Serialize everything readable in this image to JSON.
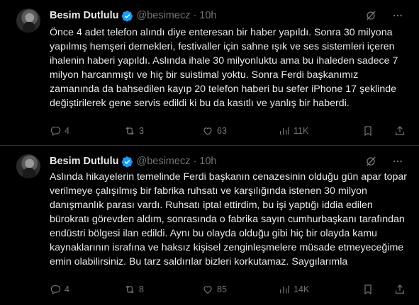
{
  "tweets": [
    {
      "author_name": "Besim Dutlulu",
      "handle": "@besimecz",
      "time_sep": "·",
      "time": "10h",
      "text": "Önce 4 adet telefon alındı diye enteresan bir haber yapıldı. Sonra 30 milyona yapılmış  hemşeri dernekleri, festivaller için sahne ışık ve ses sistemleri içeren ihalenin haberi yapıldı. Aslında ihale 30 milyonluktu ama bu ihaleden sadece 7 milyon harcanmıştı ve hiç bir suistimal yoktu. Sonra Ferdi başkanımız zamanında da bahsedilen kayıp 20 telefon haberi bu sefer iPhone 17 şeklinde değiştirilerek gene servis edildi ki bu da kasıtlı ve yanlış bir haberdi.",
      "replies": "4",
      "reposts": "3",
      "likes": "63",
      "views": "11K"
    },
    {
      "author_name": "Besim Dutlulu",
      "handle": "@besimecz",
      "time_sep": "·",
      "time": "10h",
      "text": "Aslında hikayelerin temelinde Ferdi başkanın cenazesinin olduğu gün apar topar verilmeye çalışılmış bir fabrika ruhsatı ve karşılığında istenen 30 milyon danışmanlık parası vardı. Ruhsatı iptal ettirdim, bu işi yaptığı iddia edilen bürokratı görevden aldım, sonrasında o fabrika sayın cumhurbaşkanı tarafından endüstri bölgesi ilan edildi. Aynı bu olayda olduğu gibi hiç bir olayda kamu kaynaklarının israfına ve haksız kişisel zenginleşmelere müsade etmeyeceğime emin olabilirsiniz. Bu tarz saldırılar bizleri korkutamaz. Saygılarımla",
      "replies": "4",
      "reposts": "8",
      "likes": "85",
      "views": "14K"
    }
  ],
  "icons": {
    "verified": "verified-badge-icon",
    "grok": "grok-icon",
    "more": "more-icon",
    "reply": "reply-icon",
    "repost": "repost-icon",
    "like": "like-icon",
    "views": "views-icon",
    "bookmark": "bookmark-icon",
    "share": "share-icon"
  },
  "colors": {
    "background": "#000000",
    "text": "#e7e9ea",
    "secondary": "#71767b",
    "verified": "#1d9bf0",
    "divider": "#2f3336"
  }
}
